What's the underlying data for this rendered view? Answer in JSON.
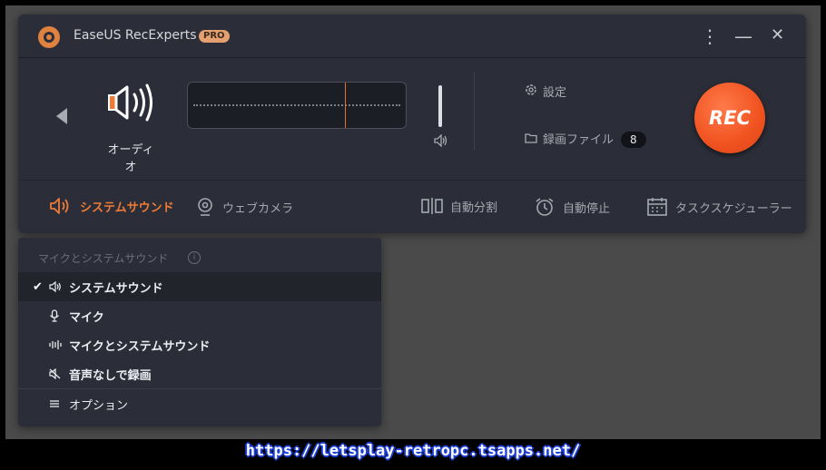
{
  "app": {
    "title": "EaseUS RecExperts",
    "badge": "PRO"
  },
  "titlebar": {
    "more_icon": "more-vertical-icon",
    "minimize_icon": "minimize-icon",
    "close_icon": "close-icon"
  },
  "source": {
    "label": "オーディオ",
    "icon": "speaker-icon"
  },
  "menu": {
    "settings": "設定",
    "recordings": "録画ファイル",
    "recordings_count": "8"
  },
  "rec_button": "REC",
  "toolbar": {
    "system_sound": "システムサウンド",
    "webcam": "ウェブカメラ",
    "auto_split": "自動分割",
    "auto_stop": "自動停止",
    "task_scheduler": "タスクスケジューラー"
  },
  "dropdown": {
    "header": "マイクとシステムサウンド",
    "items": [
      {
        "label": "システムサウンド",
        "icon": "speaker-icon",
        "selected": true
      },
      {
        "label": "マイク",
        "icon": "microphone-icon",
        "selected": false
      },
      {
        "label": "マイクとシステムサウンド",
        "icon": "audio-wave-icon",
        "selected": false
      },
      {
        "label": "音声なしで録画",
        "icon": "mute-icon",
        "selected": false
      },
      {
        "label": "オプション",
        "icon": "options-icon",
        "selected": false
      }
    ]
  },
  "watermark": "https://letsplay-retropc.tsapps.net/",
  "colors": {
    "accent": "#ef7a35",
    "rec": "#f0521f",
    "panel": "#2b2e38"
  }
}
